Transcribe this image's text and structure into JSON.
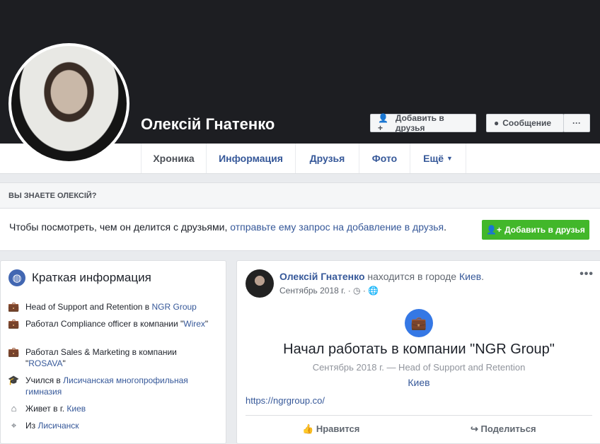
{
  "profile": {
    "name": "Олексій Гнатенко"
  },
  "header_buttons": {
    "add_friend": "Добавить в друзья",
    "message": "Сообщение",
    "more": "···"
  },
  "tabs": [
    "Хроника",
    "Информация",
    "Друзья",
    "Фото",
    "Ещё"
  ],
  "know": {
    "title": "ВЫ ЗНАЕТЕ ОЛЕКСІЙ?",
    "text": "Чтобы посмотреть, чем он делится с друзьями,",
    "link": "отправьте ему запрос на добавление в друзья",
    "period": ".",
    "button": "Добавить в друзья"
  },
  "intro": {
    "title": "Краткая информация",
    "items": [
      {
        "text": "Head of Support and Retention в ",
        "link": "NGR Group",
        "after": ""
      },
      {
        "text": "Работал Compliance officer в компании \"",
        "link": "Wirex",
        "after": "\""
      },
      {
        "text": "Работал Sales & Marketing в компании \"",
        "link": "ROSAVA",
        "after": "\""
      },
      {
        "text": "Учился в ",
        "link": "Лисичанская многопрофильная гимназия",
        "after": ""
      },
      {
        "text": "Живет в г. ",
        "link": "Киев",
        "after": ""
      },
      {
        "text": "Из ",
        "link": "Лисичанск",
        "after": ""
      }
    ]
  },
  "post": {
    "author": "Олексій Гнатенко",
    "action": " находится в городе ",
    "place": "Киев",
    "dot": ".",
    "date": "Сентябрь 2018 г.",
    "sep": " · ",
    "more": "•••",
    "event_title": "Начал работать в компании \"NGR Group\"",
    "event_sub": "Сентябрь 2018 г. — Head of Support and Retention",
    "event_place": "Киев",
    "url": "https://ngrgroup.co/",
    "like": "Нравится",
    "share": "Поделиться"
  }
}
